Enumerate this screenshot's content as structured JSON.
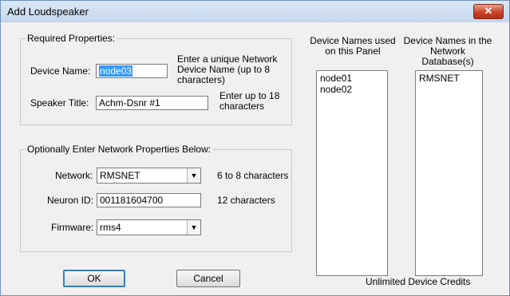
{
  "window": {
    "title": "Add Loudspeaker",
    "close_glyph": "✕"
  },
  "required": {
    "legend": "Required Properties:",
    "device_name_label": "Device Name:",
    "device_name_value": "node03",
    "device_name_hint": "Enter  a unique Network Device  Name (up to 8 characters)",
    "speaker_title_label": "Speaker Title:",
    "speaker_title_value": "Achm-Dsnr #1",
    "speaker_title_hint": "Enter up to 18 characters"
  },
  "optional": {
    "legend": "Optionally Enter Network Properties Below:",
    "network_label": "Network:",
    "network_value": "RMSNET",
    "network_hint": "6 to 8 characters",
    "neuron_label": "Neuron ID:",
    "neuron_value": "001181604700",
    "neuron_hint": "12 characters",
    "firmware_label": "Firmware:",
    "firmware_value": "rms4"
  },
  "panel_list": {
    "header": "Device Names used on this Panel",
    "items": [
      "node01",
      "node02"
    ]
  },
  "db_list": {
    "header": "Device Names in the Network Database(s)",
    "items": [
      "RMSNET"
    ]
  },
  "buttons": {
    "ok": "OK",
    "cancel": "Cancel"
  },
  "credits": "Unlimited Device Credits",
  "icons": {
    "dropdown": "▼"
  }
}
